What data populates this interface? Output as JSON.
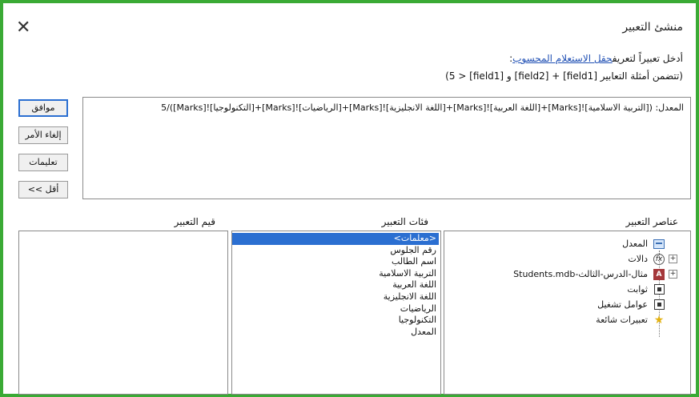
{
  "dialog": {
    "title": "منشئ التعبير",
    "close_symbol": "✕"
  },
  "instructions": {
    "prefix": "أدخل تعبيراً لتعريف",
    "link": "حقل الاستعلام المحسوب",
    "suffix": ":",
    "examples": "(تتضمن أمثلة التعابير [field1] + [field2] و [field1] < 5)"
  },
  "expression": {
    "value": "المعدل: ([التربية الاسلامية]![Marks]+[اللغة العربية]![Marks]+[اللغة الانجليزية]![Marks]+[الرياضيات]![Marks]+[التكنولوجيا]![Marks])/5"
  },
  "buttons": {
    "ok": "موافق",
    "cancel": "إلغاء الأمر",
    "help": "تعليمات",
    "less": "<< أقل"
  },
  "sections": {
    "elements": "عناصر التعبير",
    "categories": "فئات التعبير",
    "values": "قيم التعبير"
  },
  "categories": [
    "<معلمات>",
    "رقم الجلوس",
    "اسم الطالب",
    "التربية الاسلامية",
    "اللغة العربية",
    "اللغة الانجليزية",
    "الرياضيات",
    "التكنولوجيا",
    "المعدل"
  ],
  "selected_category_index": 0,
  "tree": [
    {
      "label": "المعدل",
      "icon": "form-icon",
      "expandable": false
    },
    {
      "label": "دالات",
      "icon": "function-icon",
      "expandable": true
    },
    {
      "label": "مثال-الدرس-الثالث-Students.mdb",
      "icon": "database-icon",
      "expandable": true
    },
    {
      "label": "ثوابت",
      "icon": "folder-icon",
      "expandable": false
    },
    {
      "label": "عوامل تشغيل",
      "icon": "folder-icon",
      "expandable": false
    },
    {
      "label": "تعبيرات شائعة",
      "icon": "star-icon",
      "expandable": false
    }
  ],
  "colors": {
    "frame_border": "#3aaa35",
    "link": "#1f4fb4",
    "selection": "#2b6fd1"
  }
}
